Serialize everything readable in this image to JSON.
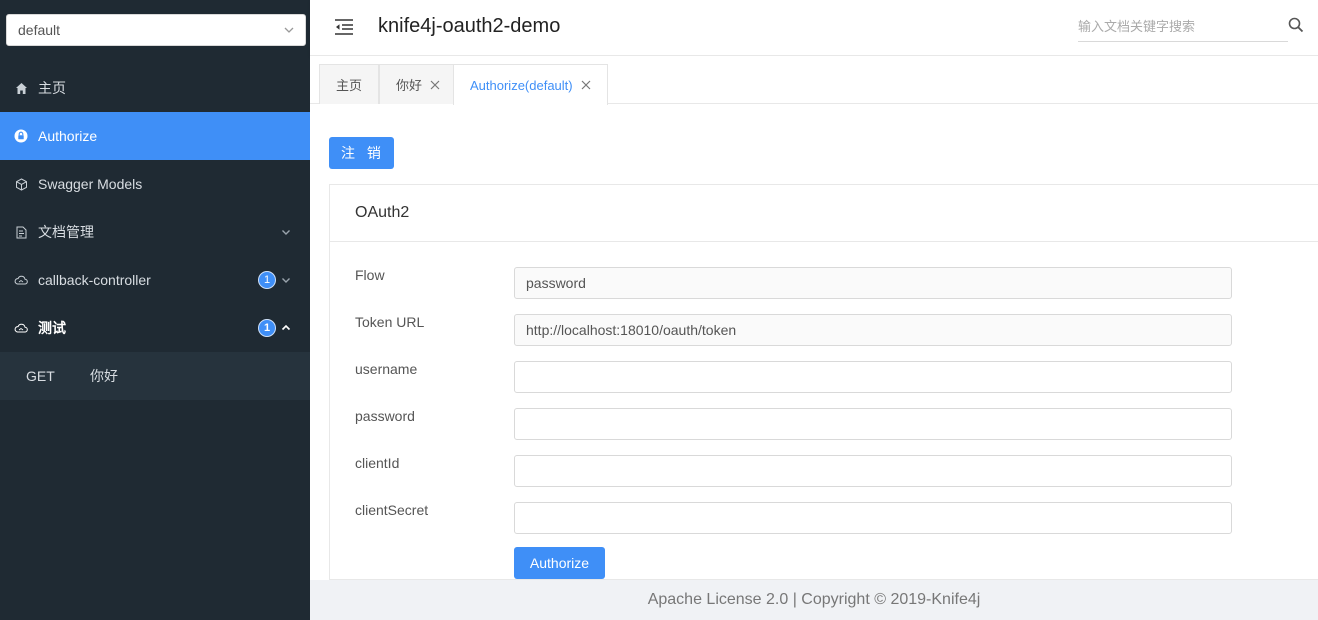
{
  "sidebar": {
    "group_select": {
      "value": "default"
    },
    "items": [
      {
        "label": "主页",
        "icon": "home-icon"
      },
      {
        "label": "Authorize",
        "icon": "lock-icon",
        "active": true
      },
      {
        "label": "Swagger Models",
        "icon": "cube-icon"
      },
      {
        "label": "文档管理",
        "icon": "document-icon"
      },
      {
        "label": "callback-controller",
        "icon": "cloud-icon",
        "badge": "1"
      },
      {
        "label": "测试",
        "icon": "cloud-icon",
        "badge": "1",
        "expanded": true
      }
    ],
    "submenu": [
      {
        "method": "GET",
        "label": "你好"
      }
    ]
  },
  "header": {
    "title": "knife4j-oauth2-demo",
    "search_placeholder": "输入文档关键字搜索"
  },
  "tabs": [
    {
      "label": "主页"
    },
    {
      "label": "你好"
    },
    {
      "label": "Authorize(default)",
      "active": true
    }
  ],
  "content": {
    "logout_label": "注 销",
    "card_title": "OAuth2",
    "fields": [
      {
        "label": "Flow",
        "value": "password"
      },
      {
        "label": "Token URL",
        "value": "http://localhost:18010/oauth/token"
      },
      {
        "label": "username",
        "value": ""
      },
      {
        "label": "password",
        "value": ""
      },
      {
        "label": "clientId",
        "value": ""
      },
      {
        "label": "clientSecret",
        "value": ""
      }
    ],
    "authorize_label": "Authorize"
  },
  "footer": {
    "text": "Apache License 2.0 | Copyright © 2019-Knife4j"
  },
  "colors": {
    "accent": "#3f8ff7",
    "sidebar_bg": "#1f2a33",
    "submenu_bg": "#26333d"
  }
}
